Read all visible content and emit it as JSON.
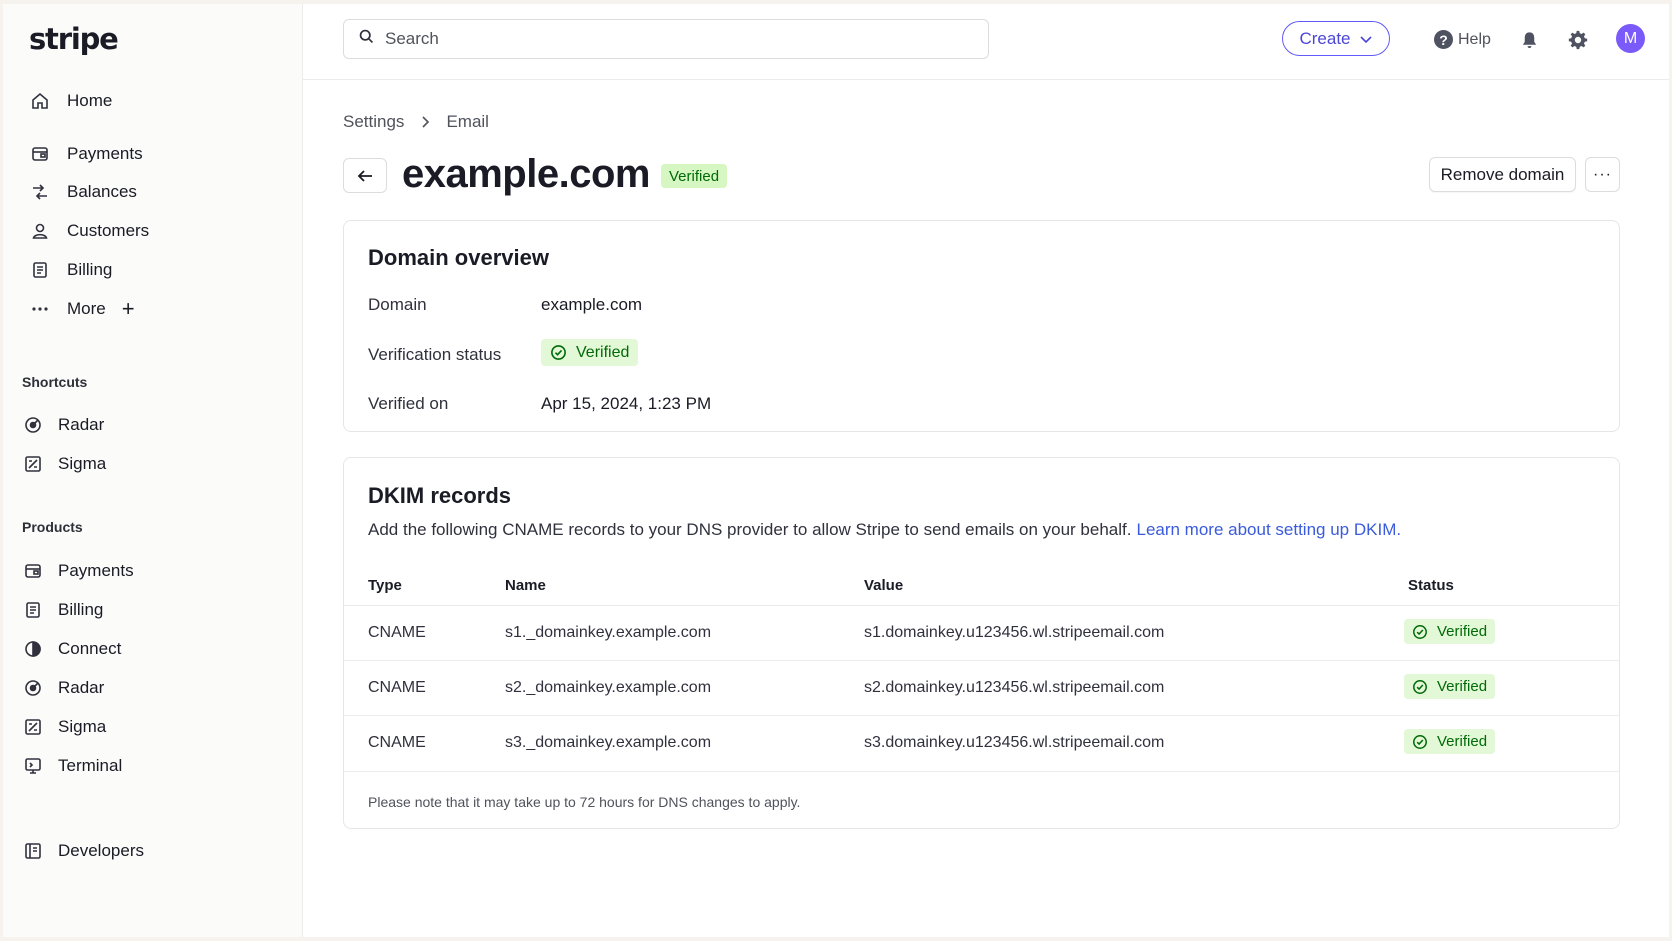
{
  "app": {
    "logo": "stripe"
  },
  "sidebar": {
    "main_items": [
      {
        "label": "Home",
        "icon": "home-icon"
      },
      {
        "label": "Payments",
        "icon": "payments-icon"
      },
      {
        "label": "Balances",
        "icon": "balances-icon"
      },
      {
        "label": "Customers",
        "icon": "customers-icon"
      },
      {
        "label": "Billing",
        "icon": "billing-icon"
      },
      {
        "label": "More",
        "icon": "more-dots-icon"
      }
    ],
    "shortcuts_label": "Shortcuts",
    "shortcuts": [
      {
        "label": "Radar",
        "icon": "radar-icon"
      },
      {
        "label": "Sigma",
        "icon": "sigma-icon"
      }
    ],
    "products_label": "Products",
    "products": [
      {
        "label": "Payments",
        "icon": "payments-icon"
      },
      {
        "label": "Billing",
        "icon": "billing-icon"
      },
      {
        "label": "Connect",
        "icon": "connect-icon"
      },
      {
        "label": "Radar",
        "icon": "radar-icon"
      },
      {
        "label": "Sigma",
        "icon": "sigma-icon"
      },
      {
        "label": "Terminal",
        "icon": "terminal-icon"
      }
    ],
    "developers": {
      "label": "Developers",
      "icon": "developers-icon"
    }
  },
  "topbar": {
    "search_placeholder": "Search",
    "create_label": "Create",
    "help_label": "Help",
    "avatar_initial": "M"
  },
  "breadcrumb": {
    "parent": "Settings",
    "current": "Email"
  },
  "header": {
    "title": "example.com",
    "badge": "Verified",
    "remove_label": "Remove domain",
    "more_label": "···"
  },
  "overview": {
    "title": "Domain overview",
    "domain_label": "Domain",
    "domain_value": "example.com",
    "status_label": "Verification status",
    "status_value": "Verified",
    "verified_on_label": "Verified on",
    "verified_on_value": "Apr 15, 2024, 1:23 PM"
  },
  "dkim": {
    "title": "DKIM records",
    "description": "Add the following CNAME records to your DNS provider to allow Stripe to send emails on your behalf.",
    "learn_more": "Learn more about setting up DKIM.",
    "columns": {
      "type": "Type",
      "name": "Name",
      "value": "Value",
      "status": "Status"
    },
    "rows": [
      {
        "type": "CNAME",
        "name": "s1._domainkey.example.com",
        "value": "s1.domainkey.u123456.wl.stripeemail.com",
        "status": "Verified"
      },
      {
        "type": "CNAME",
        "name": "s2._domainkey.example.com",
        "value": "s2.domainkey.u123456.wl.stripeemail.com",
        "status": "Verified"
      },
      {
        "type": "CNAME",
        "name": "s3._domainkey.example.com",
        "value": "s3.domainkey.u123456.wl.stripeemail.com",
        "status": "Verified"
      }
    ],
    "note": "Please note that it may take up to 72 hours for DNS changes to apply."
  },
  "colors": {
    "accent": "#625afa",
    "success_bg": "#d7f7c2",
    "success_text": "#006908",
    "link": "#3a5bdb"
  }
}
